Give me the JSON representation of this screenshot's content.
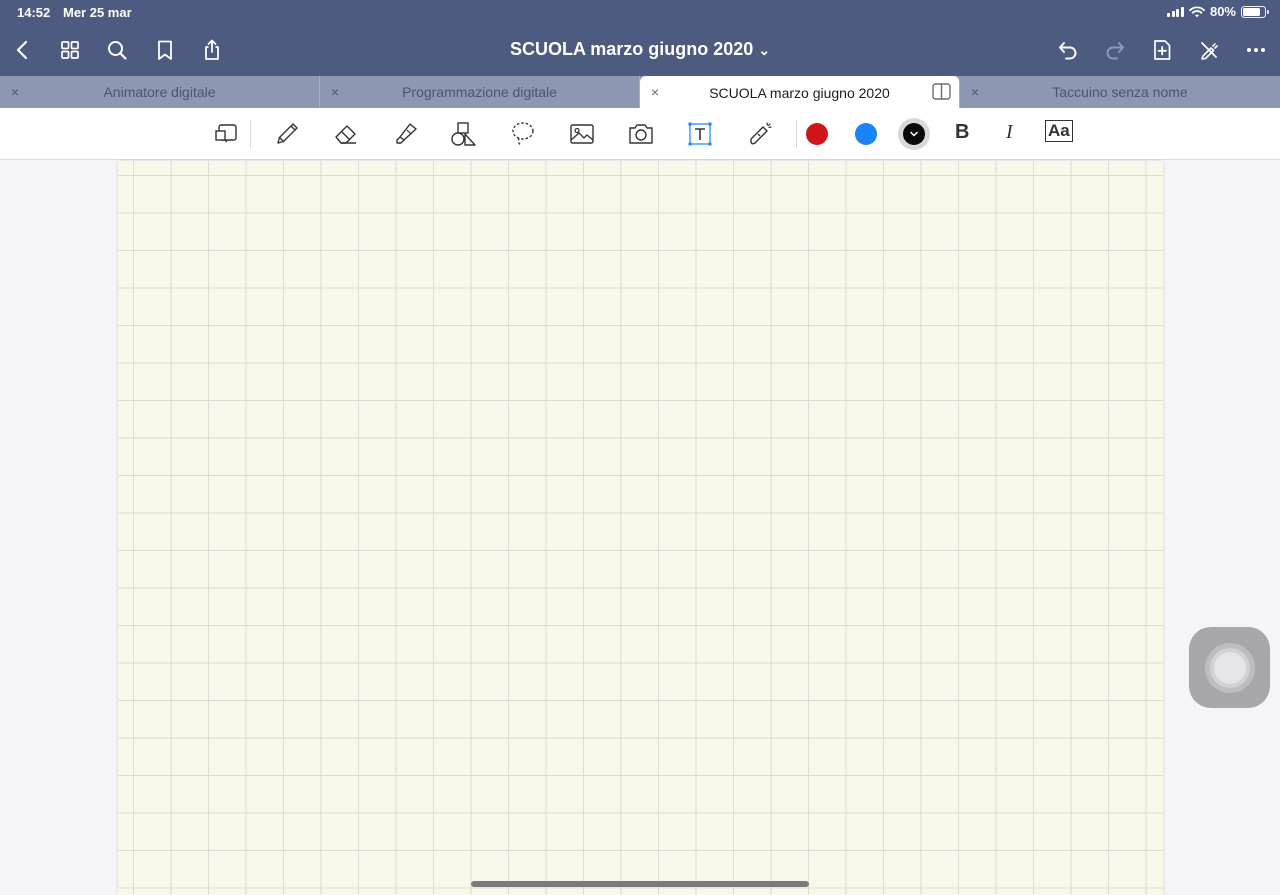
{
  "status_bar": {
    "time": "14:52",
    "date": "Mer 25 mar",
    "battery": "80%",
    "battery_level": 0.8
  },
  "header": {
    "title": "SCUOLA marzo giugno 2020",
    "title_chevron": "⌄",
    "left_icons": [
      "back-icon",
      "grid-icon",
      "search-icon",
      "bookmark-icon",
      "share-icon"
    ],
    "right_icons": [
      "undo-icon",
      "redo-icon",
      "add-page-icon",
      "pen-off-icon",
      "more-icon"
    ]
  },
  "tabs": [
    {
      "label": "Animatore digitale",
      "close": "×",
      "active": false
    },
    {
      "label": "Programmazione digitale",
      "close": "×",
      "active": false
    },
    {
      "label": "SCUOLA marzo giugno 2020",
      "close": "×",
      "active": true
    },
    {
      "label": "Taccuino senza nome",
      "close": "×",
      "active": false
    }
  ],
  "toolbar": {
    "tools": [
      "zoom-window-icon",
      "pen-icon",
      "eraser-icon",
      "highlighter-icon",
      "shapes-icon",
      "lasso-icon",
      "image-icon",
      "camera-icon",
      "text-box-icon",
      "laser-pointer-icon"
    ],
    "colors": [
      "#d0161b",
      "#1a83f5",
      "#0a0a0a"
    ],
    "selected_color": "#0a0a0a",
    "bold_label": "B",
    "italic_label": "I",
    "font_label": "Aa"
  },
  "colors": {
    "header_bg": "#4c5b7f",
    "tab_bg": "#8d97b2",
    "paper": "#f9f6ea",
    "active_tool": "#1a83f5"
  }
}
